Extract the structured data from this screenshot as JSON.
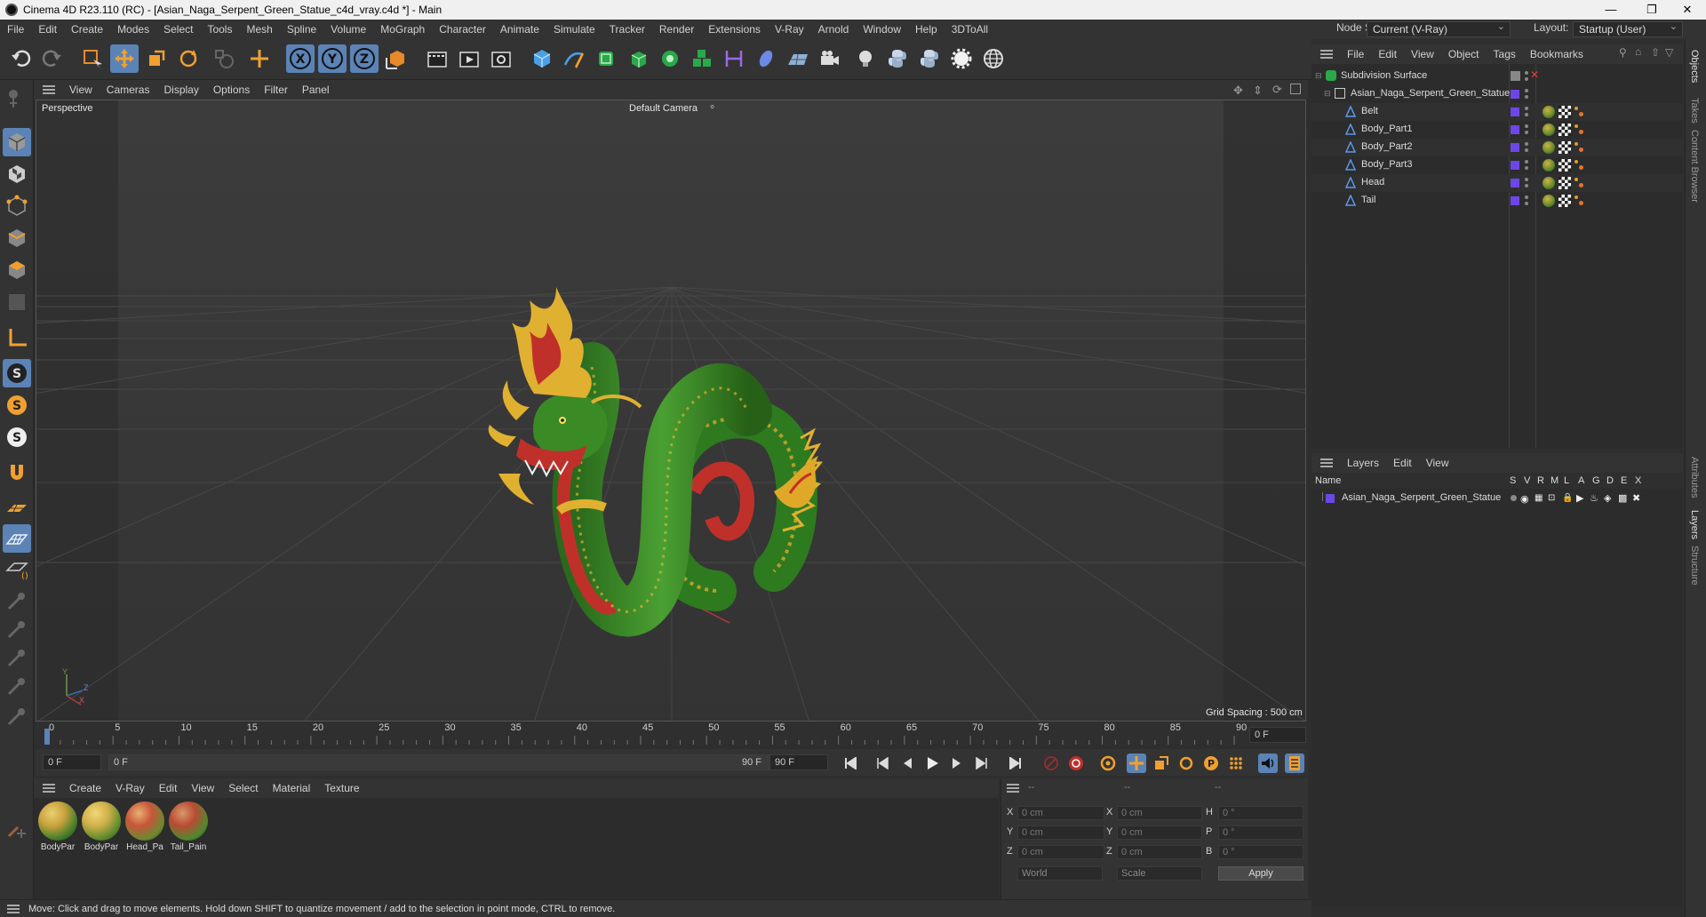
{
  "window": {
    "title": "Cinema 4D R23.110 (RC) - [Asian_Naga_Serpent_Green_Statue_c4d_vray.c4d *] - Main",
    "controls": [
      "minimize-icon",
      "maximize-icon",
      "close-icon"
    ]
  },
  "menubar": {
    "items": [
      "File",
      "Edit",
      "Create",
      "Modes",
      "Select",
      "Tools",
      "Mesh",
      "Spline",
      "Volume",
      "MoGraph",
      "Character",
      "Animate",
      "Simulate",
      "Tracker",
      "Render",
      "Extensions",
      "V-Ray",
      "Arnold",
      "Window",
      "Help",
      "3DToAll"
    ],
    "node_space_label": "Node Space:",
    "node_space_value": "Current (V-Ray)",
    "layout_label": "Layout:",
    "layout_value": "Startup (User)"
  },
  "viewport": {
    "menu": [
      "View",
      "Cameras",
      "Display",
      "Options",
      "Filter",
      "Panel"
    ],
    "view_name": "Perspective",
    "camera": "Default Camera",
    "grid_spacing": "Grid Spacing : 500 cm",
    "axis_labels": [
      "Y",
      "Z",
      "X"
    ]
  },
  "timeline": {
    "ticks": [
      "0",
      "5",
      "10",
      "15",
      "20",
      "25",
      "30",
      "35",
      "40",
      "45",
      "50",
      "55",
      "60",
      "65",
      "70",
      "75",
      "80",
      "85",
      "90"
    ],
    "current_frame_field": "0 F",
    "start_field": "0 F",
    "range_start": "0 F",
    "range_end": "90 F",
    "end_field": "90 F",
    "frame_display": "0 F"
  },
  "materials": {
    "menu": [
      "Create",
      "V-Ray",
      "Edit",
      "View",
      "Select",
      "Material",
      "Texture"
    ],
    "items": [
      {
        "label": "BodyPar",
        "color_a": "#c9a23c",
        "color_b": "#3f7d2a"
      },
      {
        "label": "BodyPar",
        "color_a": "#d0b04a",
        "color_b": "#5a8a2c"
      },
      {
        "label": "Head_Pa",
        "color_a": "#c8553a",
        "color_b": "#6b8a30"
      },
      {
        "label": "Tail_Pain",
        "color_a": "#b84b34",
        "color_b": "#4f8a2e"
      }
    ]
  },
  "coordinates": {
    "header": [
      "--",
      "--",
      "--"
    ],
    "rows": [
      {
        "a": "X",
        "av": "0 cm",
        "b": "X",
        "bv": "0 cm",
        "c": "H",
        "cv": "0 °"
      },
      {
        "a": "Y",
        "av": "0 cm",
        "b": "Y",
        "bv": "0 cm",
        "c": "P",
        "cv": "0 °"
      },
      {
        "a": "Z",
        "av": "0 cm",
        "b": "Z",
        "bv": "0 cm",
        "c": "B",
        "cv": "0 °"
      }
    ],
    "mode_select": "World",
    "scale_select": "Scale",
    "apply_label": "Apply"
  },
  "status": "Move: Click and drag to move elements. Hold down SHIFT to quantize movement / add to the selection in point mode, CTRL to remove.",
  "objects": {
    "menu": [
      "File",
      "Edit",
      "View",
      "Object",
      "Tags",
      "Bookmarks"
    ],
    "tree": [
      {
        "name": "Subdivision Surface",
        "level": 0
      },
      {
        "name": "Asian_Naga_Serpent_Green_Statue",
        "level": 1
      },
      {
        "name": "Belt",
        "level": 2
      },
      {
        "name": "Body_Part1",
        "level": 2
      },
      {
        "name": "Body_Part2",
        "level": 2
      },
      {
        "name": "Body_Part3",
        "level": 2
      },
      {
        "name": "Head",
        "level": 2
      },
      {
        "name": "Tail",
        "level": 2
      }
    ]
  },
  "layers": {
    "menu": [
      "Layers",
      "Edit",
      "View"
    ],
    "name_header": "Name",
    "columns": [
      "S",
      "V",
      "R",
      "M",
      "L",
      "A",
      "G",
      "D",
      "E",
      "X"
    ],
    "rows": [
      {
        "name": "Asian_Naga_Serpent_Green_Statue",
        "color": "#6c47e6"
      }
    ]
  },
  "side_tabs": [
    "Objects",
    "Takes",
    "Content Browser",
    "Attributes",
    "Layers",
    "Structure"
  ],
  "colors": {
    "accent": "#5b83b6",
    "layer_purple": "#6c47e6",
    "serpent_green": "#3f8f2a",
    "serpent_red": "#c0302a",
    "serpent_gold": "#e0b030"
  }
}
